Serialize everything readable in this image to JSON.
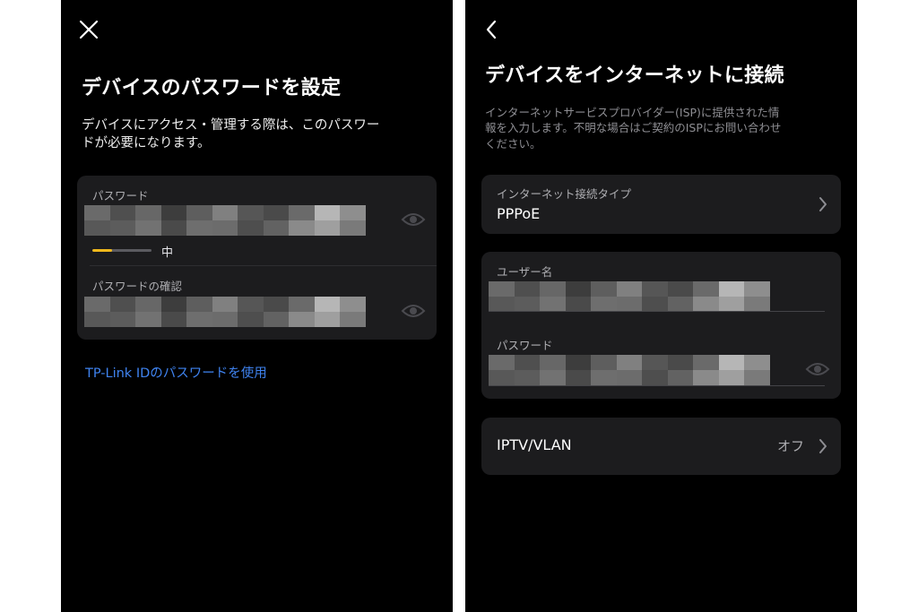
{
  "left_screen": {
    "title": "デバイスのパスワードを設定",
    "description_lines": [
      "デバイスにアクセス・管理する際は、このパスワー",
      "ドが必要になります。"
    ],
    "password_label": "パスワード",
    "strength": {
      "level": 0.33,
      "label": "中",
      "color": "#f0b81c"
    },
    "confirm_label": "パスワードの確認",
    "link_label": "TP-Link IDのパスワードを使用"
  },
  "right_screen": {
    "title": "デバイスをインターネットに接続",
    "description_lines": [
      "インターネットサービスプロバイダー(ISP)に提供された情",
      "報を入力します。不明な場合はご契約のISPにお問い合わせ",
      "ください。"
    ],
    "connection_type_label": "インターネット接続タイプ",
    "connection_type_value": "PPPoE",
    "username_label": "ユーザー名",
    "password_label": "パスワード",
    "iptv_label": "IPTV/VLAN",
    "iptv_value": "オフ"
  },
  "colors": {
    "background": "#000000",
    "card": "#1c1c1e",
    "link": "#3f83f0",
    "strength_bar": "#f0b81c"
  },
  "icons": {
    "close": "close-icon",
    "back": "back-arrow-icon",
    "eye": "eye-icon",
    "chevron": "chevron-right-icon"
  }
}
